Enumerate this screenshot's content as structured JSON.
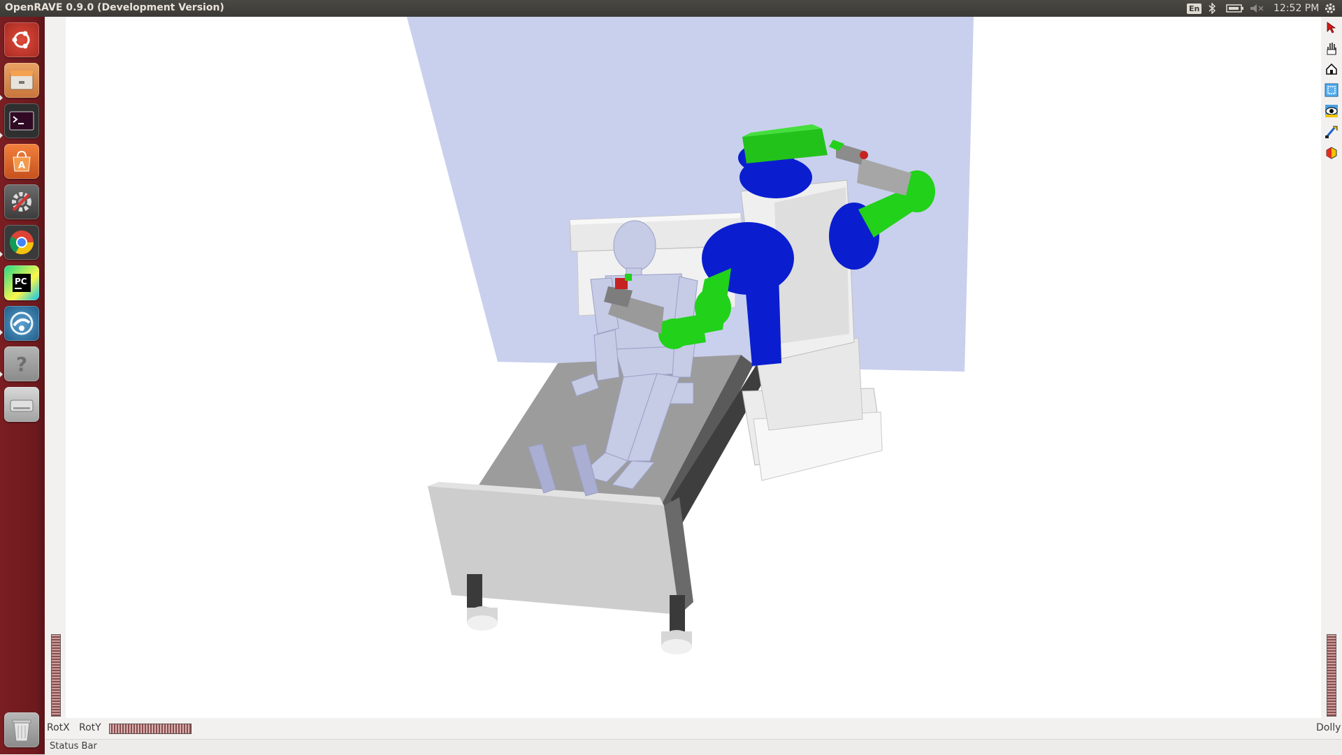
{
  "window": {
    "title": "OpenRAVE 0.9.0 (Development Version)"
  },
  "panel": {
    "keyboard_indicator": "En",
    "bluetooth_icon": "bluetooth-icon",
    "battery_icon": "battery-icon",
    "volume_icon": "volume-muted-icon",
    "clock": "12:52 PM",
    "settings_icon": "gear-icon"
  },
  "launcher": {
    "items": [
      {
        "name": "ubuntu-dash-icon",
        "color": "#c1362f"
      },
      {
        "name": "files-icon",
        "color": "#d9824a"
      },
      {
        "name": "terminal-icon",
        "color": "#2c2c2c"
      },
      {
        "name": "software-center-icon",
        "color": "#e0632a"
      },
      {
        "name": "system-settings-icon",
        "color": "#8a8a8a"
      },
      {
        "name": "chrome-icon",
        "color": "#4a8bd6"
      },
      {
        "name": "pycharm-icon",
        "color": "#21d789"
      },
      {
        "name": "network-icon",
        "color": "#3b7ca8"
      },
      {
        "name": "help-icon",
        "color": "#9a9a9a"
      },
      {
        "name": "drive-icon",
        "color": "#c7c7c7"
      }
    ],
    "trash_icon": "trash-icon"
  },
  "toolbar": {
    "tools": [
      "select-arrow-icon",
      "hand-pan-icon",
      "home-view-icon",
      "view-all-icon",
      "seek-eye-icon",
      "perspective-icon",
      "render-mode-icon"
    ]
  },
  "controls": {
    "rot_x": "RotX",
    "rot_y": "RotY",
    "dolly": "Dolly"
  },
  "status": {
    "text": "Status Bar"
  },
  "colors": {
    "wall": "#c9d0ed",
    "robot_blue": "#0a1ecf",
    "robot_green": "#22d11a",
    "robot_white": "#eeeeee",
    "bed_gray": "#9c9c9c",
    "human": "#c6cbe6"
  }
}
